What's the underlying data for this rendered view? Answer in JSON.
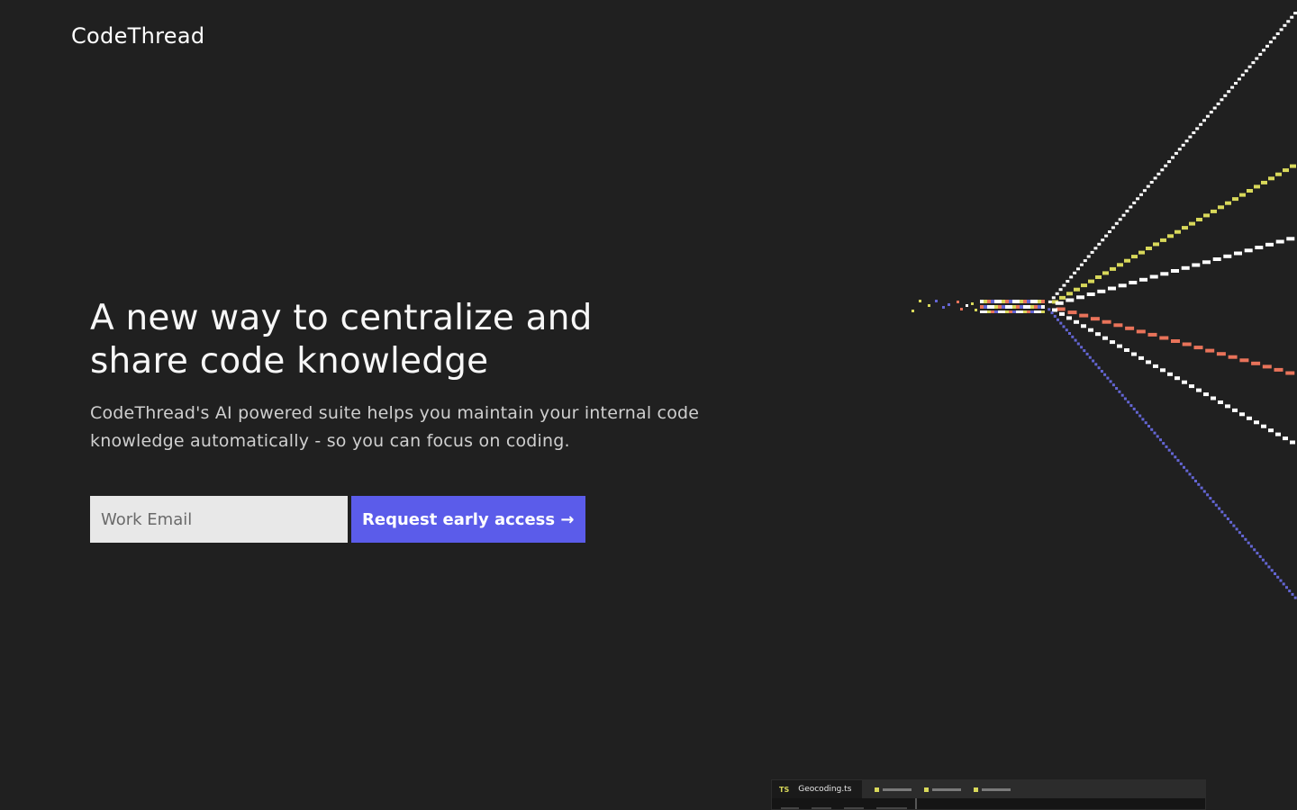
{
  "brand": {
    "logo_text": "CodeThread"
  },
  "hero": {
    "title_line1": "A new way to centralize and",
    "title_line2": "share code knowledge",
    "subtitle_line1": "CodeThread's AI powered suite helps you maintain your internal code",
    "subtitle_line2": "knowledge automatically - so you can focus on coding."
  },
  "signup": {
    "email_placeholder": "Work Email",
    "cta_label": "Request early access →"
  },
  "colors": {
    "background": "#202020",
    "accent": "#5b5cea",
    "thread_white": "#ffffff",
    "thread_yellow": "#d8d85a",
    "thread_orange": "#e9735a",
    "thread_blue": "#6466d4"
  },
  "editor_preview": {
    "language_badge": "TS",
    "file_name": "Geocoding.ts"
  }
}
